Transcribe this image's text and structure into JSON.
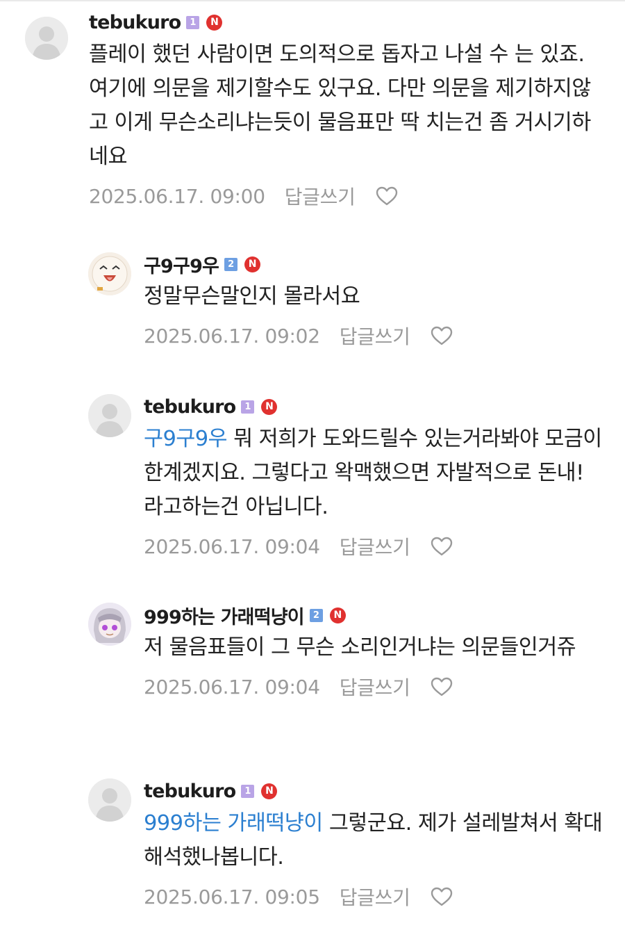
{
  "comments": [
    {
      "nickname": "tebukuro",
      "level": "1",
      "n_badge": "N",
      "avatar": "default-profile",
      "mention": "",
      "text": "플레이 했던 사람이면 도의적으로 돕자고 나설 수 는 있죠. 여기에 의문을 제기할수도 있구요. 다만 의문을 제기하지않고 이게 무슨소리냐는듯이 물음표만 딱 치는건 좀 거시기하네요",
      "date": "2025.06.17. 09:00",
      "reply_label": "답글쓰기"
    },
    {
      "nickname": "구9구9우",
      "level": "2",
      "n_badge": "N",
      "avatar": "custom-profile-face",
      "mention": "",
      "text": "정말무슨말인지 몰라서요",
      "date": "2025.06.17. 09:02",
      "reply_label": "답글쓰기"
    },
    {
      "nickname": "tebukuro",
      "level": "1",
      "n_badge": "N",
      "avatar": "default-profile",
      "mention": "구9구9우",
      "text": "뭐 저희가 도와드릴수 있는거라봐야 모금이 한계겠지요. 그렇다고 왁맥했으면 자발적으로 돈내! 라고하는건 아닙니다.",
      "date": "2025.06.17. 09:04",
      "reply_label": "답글쓰기"
    },
    {
      "nickname": "999하는 가래떡냥이",
      "level": "2",
      "n_badge": "N",
      "avatar": "custom-profile-anime",
      "mention": "",
      "text": "저 물음표들이 그 무슨 소리인거냐는 의문들인거쥬",
      "date": "2025.06.17. 09:04",
      "reply_label": "답글쓰기"
    },
    {
      "nickname": "tebukuro",
      "level": "1",
      "n_badge": "N",
      "avatar": "default-profile",
      "mention": "999하는 가래떡냥이",
      "text": "그렇군요. 제가 설레발쳐서 확대해석했나봅니다.",
      "date": "2025.06.17. 09:05",
      "reply_label": "답글쓰기"
    }
  ],
  "colors": {
    "mention": "#2b7fd0",
    "n_badge": "#e0312f",
    "level1": "#b9a4e6",
    "level2": "#6d9fe2",
    "meta": "#9a9a9a"
  },
  "icons": {
    "like": "heart-outline-icon",
    "default_avatar": "person-silhouette-icon"
  }
}
